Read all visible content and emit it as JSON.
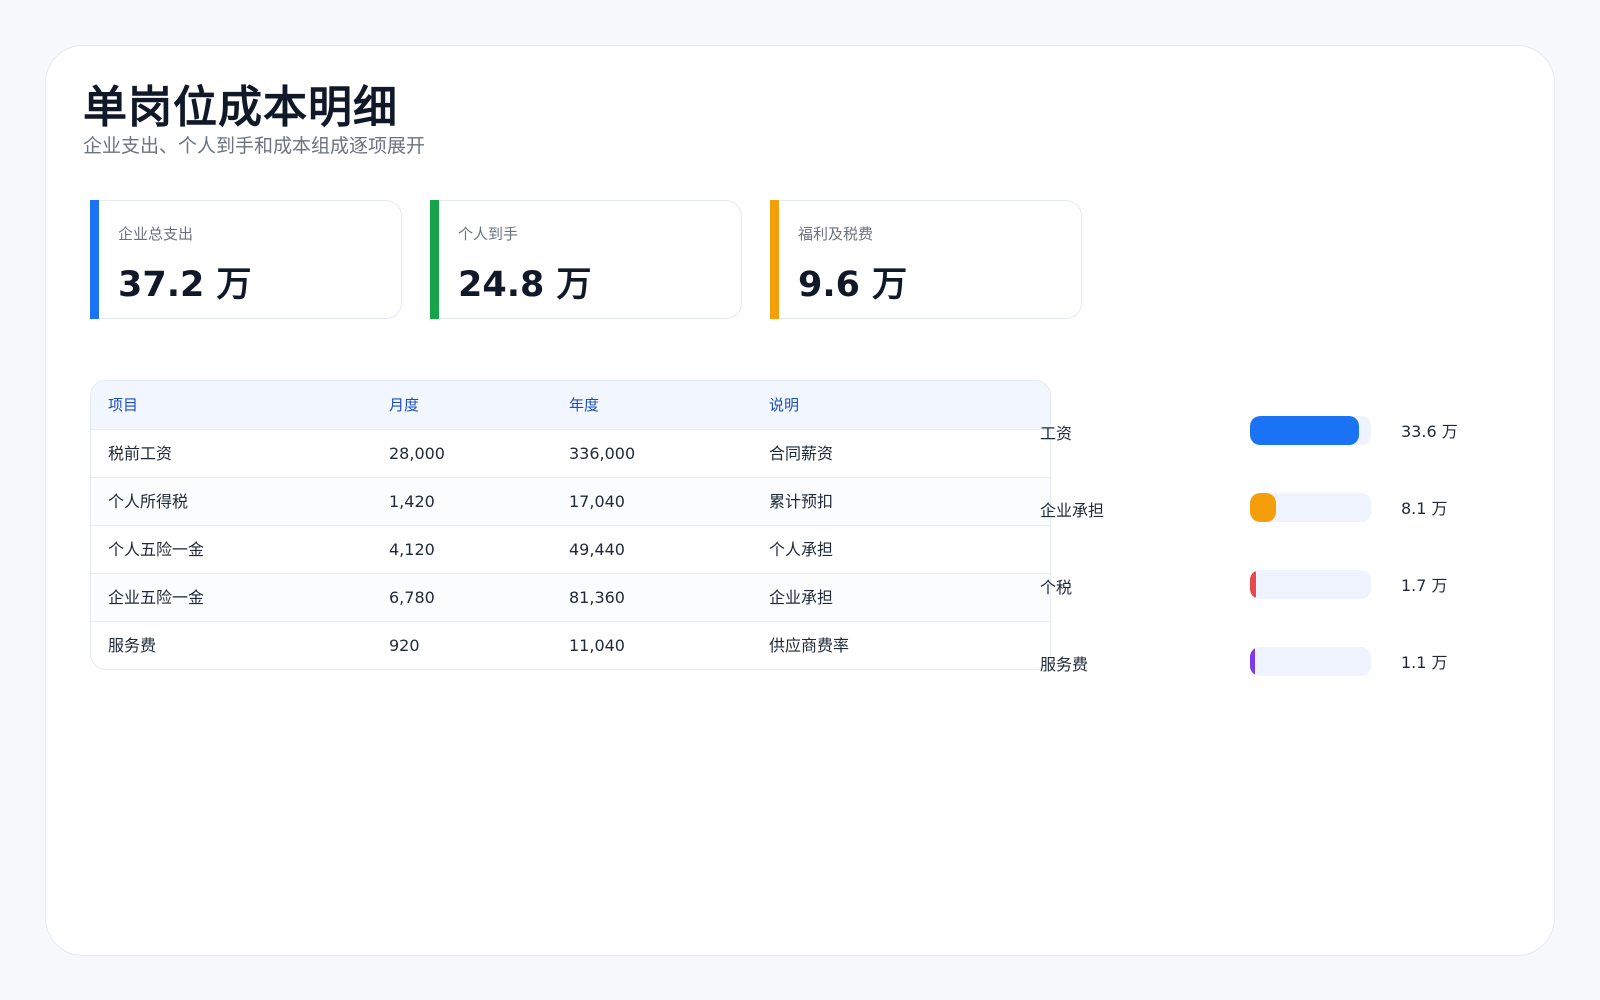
{
  "header": {
    "title": "单岗位成本明细",
    "subtitle": "企业支出、个人到手和成本组成逐项展开"
  },
  "kpis": [
    {
      "label": "企业总支出",
      "value": "37.2 万",
      "color": "#1a73f5"
    },
    {
      "label": "个人到手",
      "value": "24.8 万",
      "color": "#16a34a"
    },
    {
      "label": "福利及税费",
      "value": "9.6 万",
      "color": "#f59e0b"
    }
  ],
  "table": {
    "headers": [
      "项目",
      "月度",
      "年度",
      "说明"
    ],
    "rows": [
      [
        "税前工资",
        "28,000",
        "336,000",
        "合同薪资"
      ],
      [
        "个人所得税",
        "1,420",
        "17,040",
        "累计预扣"
      ],
      [
        "个人五险一金",
        "4,120",
        "49,440",
        "个人承担"
      ],
      [
        "企业五险一金",
        "6,780",
        "81,360",
        "企业承担"
      ],
      [
        "服务费",
        "920",
        "11,040",
        "供应商费率"
      ]
    ]
  },
  "breakdown": {
    "scale_max": 37.2,
    "items": [
      {
        "label": "工资",
        "value": 33.6,
        "value_label": "33.6 万",
        "color": "#1a73f5"
      },
      {
        "label": "企业承担",
        "value": 8.1,
        "value_label": "8.1 万",
        "color": "#f59e0b"
      },
      {
        "label": "个税",
        "value": 1.7,
        "value_label": "1.7 万",
        "color": "#e5484d"
      },
      {
        "label": "服务费",
        "value": 1.1,
        "value_label": "1.1 万",
        "color": "#7c3aed"
      }
    ]
  }
}
